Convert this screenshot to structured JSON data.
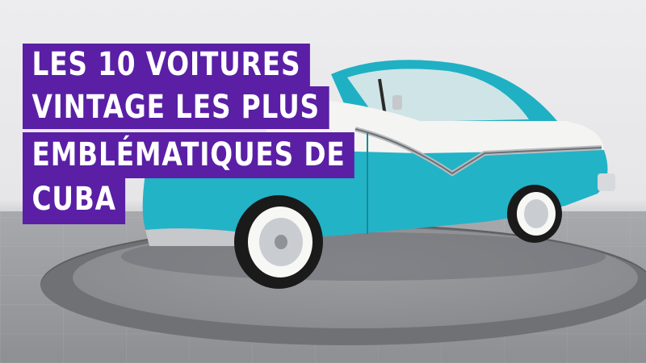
{
  "headline": {
    "lines": [
      "LES 10 VOITURES",
      "VINTAGE LES PLUS",
      "EMBLÉMATIQUES DE",
      "CUBA"
    ]
  },
  "colors": {
    "banner_background": "#5a1fa5",
    "banner_text": "#ffffff",
    "car_turquoise": "#22b3c7",
    "car_white": "#f4f4f2"
  },
  "photo": {
    "subject_icon": "vintage-car-icon"
  }
}
